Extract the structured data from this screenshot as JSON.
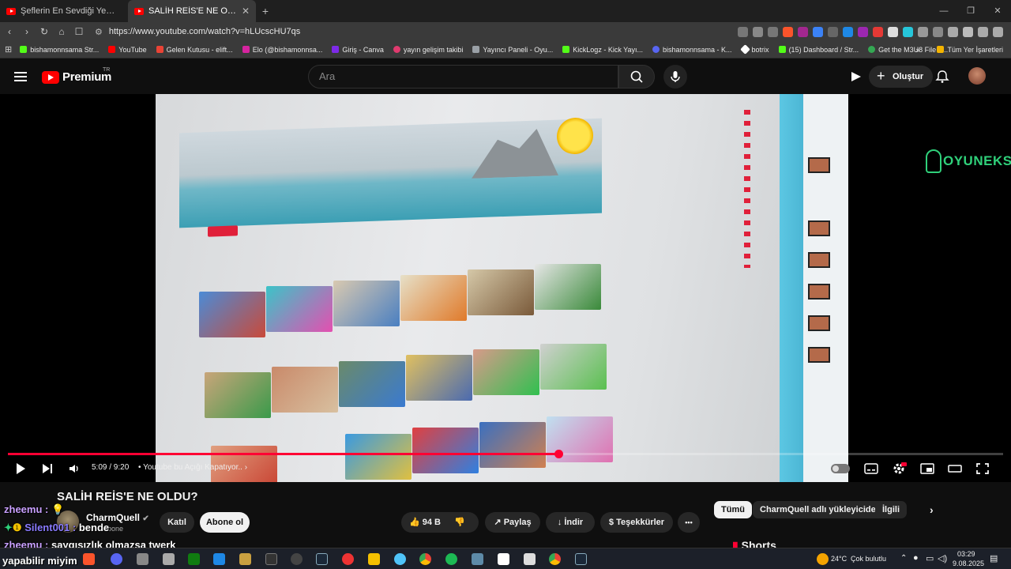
{
  "browser": {
    "tabs": [
      {
        "title": "Şeflerin En Sevdiği Yemekler – Antho",
        "active": false
      },
      {
        "title": "SALİH REİS'E NE OLDU? - YouTu",
        "active": true
      }
    ],
    "new_tab": "+",
    "url": "https://www.youtube.com/watch?v=hLUcscHU7qs",
    "bookmarks": [
      {
        "label": "bishamonnsama Str...",
        "color": "#53fc18"
      },
      {
        "label": "YouTube",
        "color": "#ff0000"
      },
      {
        "label": "Gelen Kutusu - elift...",
        "color": "#ea4335"
      },
      {
        "label": "Elo (@bishamonnsa...",
        "color": "#d6249f"
      },
      {
        "label": "Giriş - Canva",
        "color": "#7d2ae8"
      },
      {
        "label": "yayın gelişim takibi",
        "color": "#e03a6e"
      },
      {
        "label": "Yayıncı Paneli - Oyu...",
        "color": "#9aa0a6"
      },
      {
        "label": "KickLogz - Kick Yayı...",
        "color": "#53fc18"
      },
      {
        "label": "bishamonnsama - K...",
        "color": "#5865f2"
      },
      {
        "label": "botrix",
        "color": "#ffffff"
      },
      {
        "label": "(15) Dashboard / Str...",
        "color": "#53fc18"
      },
      {
        "label": "Get the M3U8 File fr...",
        "color": "#34a853"
      }
    ],
    "bookmarks_overflow": "»",
    "all_bookmarks": "Tüm Yer İşaretleri"
  },
  "youtube": {
    "logo_text": "Premium",
    "logo_region": "TR",
    "search_placeholder": "Ara",
    "create_label": "Oluştur"
  },
  "player": {
    "current_time": "5:09 / 9:20",
    "chapter": "Youtube bu Açığı Kapatıyor..",
    "progress": 0.553,
    "watermark": "OYUNEKS"
  },
  "video": {
    "title": "SALİH REİS'E NE OLDU?",
    "channel_name": "CharmQuell",
    "subscribers": "Abone",
    "join_label": "Katıl",
    "subscribe_label": "Abone ol",
    "likes": "94 B",
    "share_label": "Paylaş",
    "download_label": "İndir",
    "thanks_label": "Teşekkürler",
    "more": "•••"
  },
  "chips": [
    "Tümü",
    "CharmQuell adlı yükleyiciden",
    "İlgili"
  ],
  "shorts_label": "Shorts",
  "chat_overlay": [
    {
      "user": "zheemu :",
      "text": "",
      "color": "#c9a0ff"
    },
    {
      "user": "Silent001 :",
      "text": "bende",
      "color": "#8a7bff"
    },
    {
      "user": "zheemu :",
      "text": "saygısızlık olmazsa twerk",
      "color": "#c9a0ff"
    },
    {
      "user": "",
      "text": "yapabilir miyim",
      "color": "#ffffff"
    }
  ],
  "taskbar": {
    "weather_temp": "24°C",
    "weather_text": "Çok bulutlu",
    "time": "03:29",
    "date": "9.08.2025"
  }
}
